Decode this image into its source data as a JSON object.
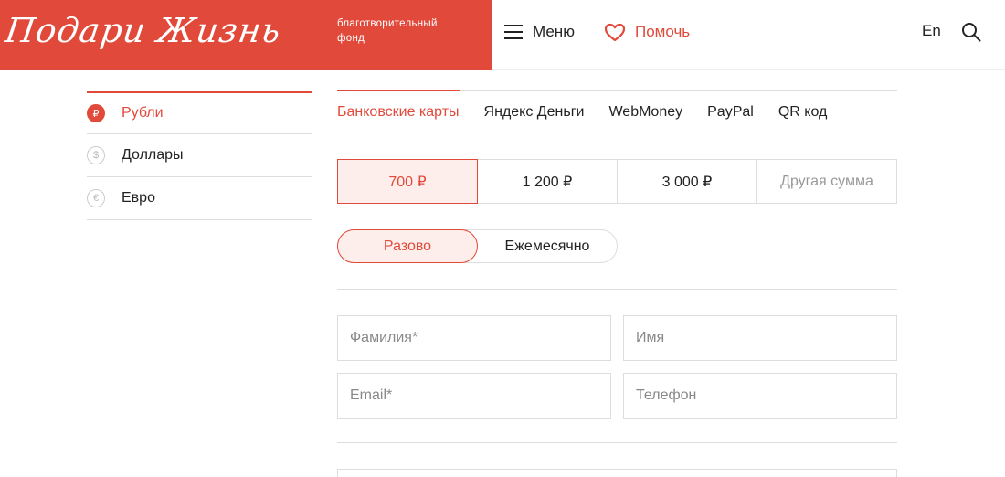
{
  "header": {
    "logo_text": "Подари Жизнь",
    "fund_line1": "благотворительный",
    "fund_line2": "фонд",
    "menu_label": "Меню",
    "help_label": "Помочь",
    "lang_label": "En",
    "accent_color": "#e14a3b"
  },
  "currencies": [
    {
      "symbol": "₽",
      "label": "Рубли",
      "active": true
    },
    {
      "symbol": "$",
      "label": "Доллары",
      "active": false
    },
    {
      "symbol": "€",
      "label": "Евро",
      "active": false
    }
  ],
  "payment_tabs": [
    {
      "label": "Банковские карты",
      "active": true
    },
    {
      "label": "Яндекс Деньги",
      "active": false
    },
    {
      "label": "WebMoney",
      "active": false
    },
    {
      "label": "PayPal",
      "active": false
    },
    {
      "label": "QR код",
      "active": false
    }
  ],
  "amounts": [
    {
      "label": "700 ₽",
      "active": true
    },
    {
      "label": "1 200 ₽",
      "active": false
    },
    {
      "label": "3 000 ₽",
      "active": false
    }
  ],
  "custom_amount_placeholder": "Другая сумма",
  "frequency": [
    {
      "label": "Разово",
      "active": true
    },
    {
      "label": "Ежемесячно",
      "active": false
    }
  ],
  "form": {
    "last_name_placeholder": "Фамилия*",
    "first_name_placeholder": "Имя",
    "email_placeholder": "Email*",
    "phone_placeholder": "Телефон"
  }
}
